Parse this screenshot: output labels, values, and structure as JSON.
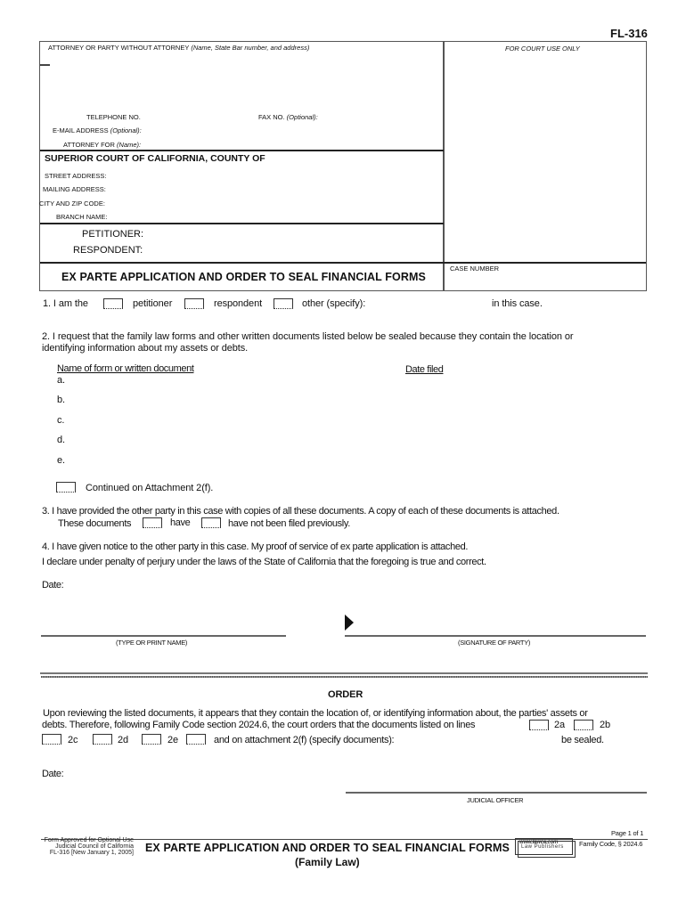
{
  "form_number": "FL-316",
  "header": {
    "attorney_label": "ATTORNEY OR PARTY WITHOUT ATTORNEY",
    "attorney_label_hint": "(Name, State Bar number, and address)",
    "court_use_label": "FOR COURT USE ONLY",
    "telephone_label": "TELEPHONE NO.",
    "fax_label": "FAX NO.",
    "fax_hint": "(Optional):",
    "email_label": "E-MAIL ADDRESS",
    "email_hint": "(Optional):",
    "attorney_for_label": "ATTORNEY FOR",
    "attorney_for_hint": "(Name):",
    "court_title": "SUPERIOR COURT OF CALIFORNIA, COUNTY OF",
    "street_address_label": "STREET ADDRESS:",
    "mailing_address_label": "MAILING ADDRESS:",
    "city_zip_label": "CITY AND ZIP CODE:",
    "branch_name_label": "BRANCH NAME:",
    "petitioner_label": "PETITIONER:",
    "respondent_label": "RESPONDENT:",
    "document_title": "EX PARTE APPLICATION AND ORDER TO SEAL FINANCIAL FORMS",
    "case_number_label": "CASE NUMBER"
  },
  "item1": {
    "prefix": "1. I am the",
    "options": [
      "petitioner",
      "respondent",
      "other (specify):"
    ],
    "suffix": "in this case."
  },
  "item2": {
    "text_line1": "2. I request that the family law forms and other written documents listed below be sealed because they contain the location or",
    "text_line2": "identifying information about my assets or debts.",
    "col_name_header": "Name of form or written document",
    "col_date_header": "Date filed",
    "rows": [
      "a.",
      "b.",
      "c.",
      "d.",
      "e."
    ],
    "continued_label": "Continued on Attachment 2(f)."
  },
  "item3": {
    "text": "3. I have provided the other party in this case with copies of all these documents. A copy of each of these documents is attached.",
    "prefix": "These documents",
    "option_have": "have",
    "option_have_not": "have not been filed previously."
  },
  "item4": {
    "text": "4. I have given notice to the other party in this case. My proof of service of ex parte application is attached."
  },
  "declaration": "I declare under penalty of perjury under the laws of the State of California that the foregoing is true and correct.",
  "date_label": "Date:",
  "type_name_label": "(TYPE OR PRINT NAME)",
  "signature_label": "(SIGNATURE OF PARTY)",
  "order": {
    "title": "ORDER",
    "text_line1": "Upon reviewing the listed documents, it appears that they contain the location of, or identifying information about, the parties' assets or",
    "text_line2": "debts. Therefore, following Family Code section 2024.6, the court orders that the documents listed on lines",
    "line_options": [
      "2a",
      "2b",
      "2c",
      "2d",
      "2e"
    ],
    "attachment_label": "and on attachment 2(f) (specify documents):",
    "sealed_suffix": "be sealed.",
    "date_label": "Date:",
    "judicial_officer_label": "JUDICIAL OFFICER"
  },
  "footer": {
    "approval_line1": "Form Approved for Optional Use",
    "approval_line2": "Judicial Council of California",
    "approval_line3": "FL-316 [New January 1, 2005]",
    "title": "EX PARTE APPLICATION AND ORDER TO SEAL FINANCIAL FORMS",
    "subtitle": "(Family Law)",
    "stamp_line1": "www.lawca.com",
    "stamp_line2": "Law Publishers",
    "page_label": "Page 1 of 1",
    "code_citation": "Family Code, § 2024.6"
  }
}
